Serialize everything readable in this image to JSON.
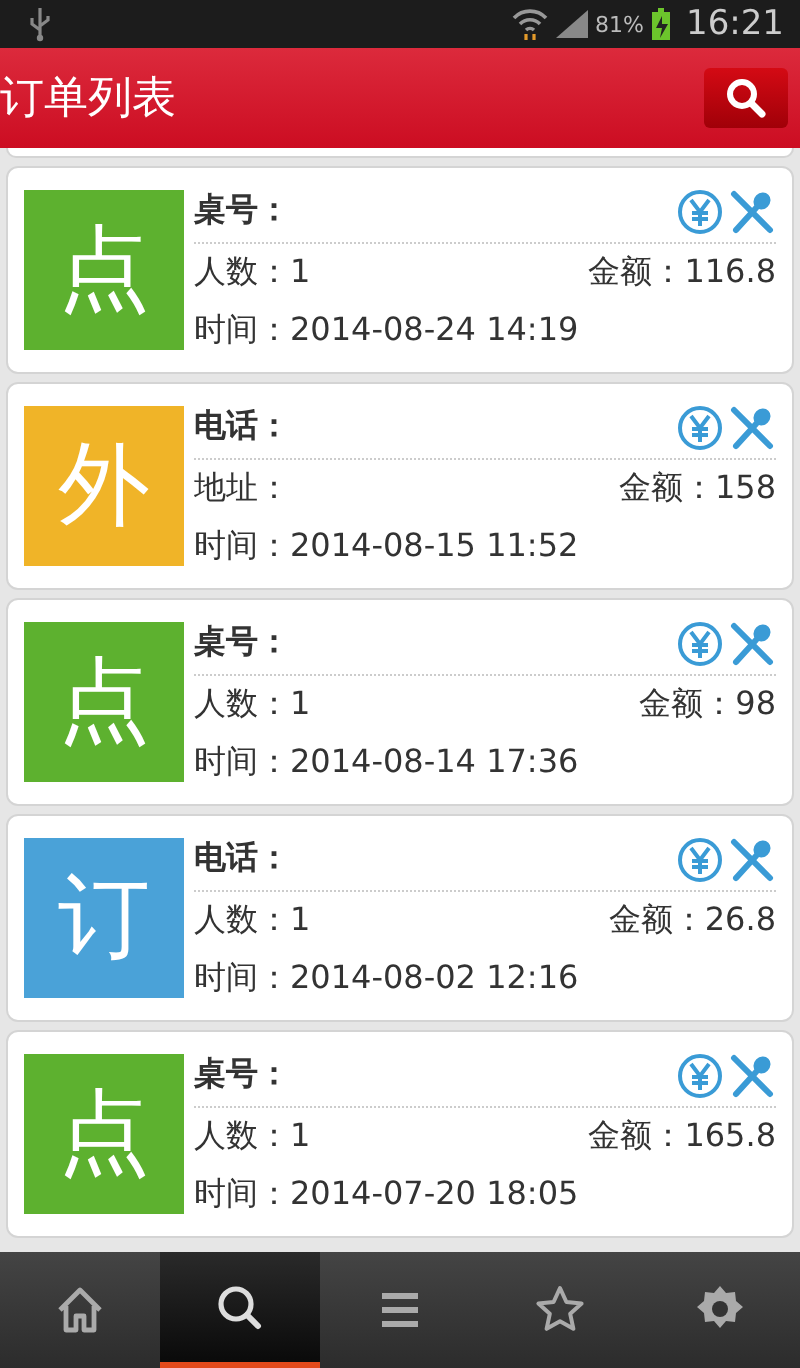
{
  "status_bar": {
    "battery": "81%",
    "time": "16:21"
  },
  "header": {
    "title": "订单列表"
  },
  "orders": [
    {
      "badge": "点",
      "color": "#5db12f",
      "label": "桌号：",
      "info": "人数：1",
      "amount": "金额：116.8",
      "time": "时间：2014-08-24 14:19"
    },
    {
      "badge": "外",
      "color": "#f0b428",
      "label": "电话：",
      "info": "地址：",
      "amount": "金额：158",
      "time": "时间：2014-08-15 11:52"
    },
    {
      "badge": "点",
      "color": "#5db12f",
      "label": "桌号：",
      "info": "人数：1",
      "amount": "金额：98",
      "time": "时间：2014-08-14 17:36"
    },
    {
      "badge": "订",
      "color": "#4aa2d8",
      "label": "电话：",
      "info": "人数：1",
      "amount": "金额：26.8",
      "time": "时间：2014-08-02 12:16"
    },
    {
      "badge": "点",
      "color": "#5db12f",
      "label": "桌号：",
      "info": "人数：1",
      "amount": "金额：165.8",
      "time": "时间：2014-07-20 18:05"
    }
  ],
  "nav": [
    {
      "kind": "home",
      "selected": false
    },
    {
      "kind": "search",
      "selected": true
    },
    {
      "kind": "menu",
      "selected": false
    },
    {
      "kind": "star",
      "selected": false
    },
    {
      "kind": "settings",
      "selected": false
    }
  ]
}
